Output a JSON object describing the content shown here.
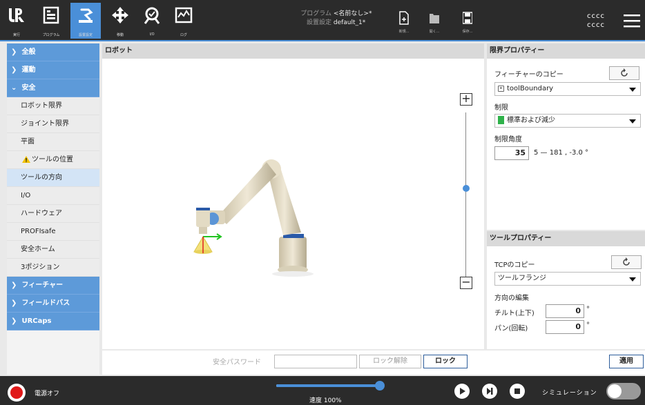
{
  "header": {
    "nav": [
      {
        "label": "実行",
        "icon": "ur-logo-icon"
      },
      {
        "label": "プログラム",
        "icon": "program-icon"
      },
      {
        "label": "設置設定",
        "icon": "installation-icon"
      },
      {
        "label": "移動",
        "icon": "move-icon"
      },
      {
        "label": "I/O",
        "icon": "io-icon"
      },
      {
        "label": "ログ",
        "icon": "log-icon"
      }
    ],
    "program_key": "プログラム",
    "program_value": "<名前なし>*",
    "install_key": "設置設定",
    "install_value": "default_1*",
    "file_new": "新規...",
    "file_open": "開く...",
    "file_save": "保存...",
    "user_line1": "cccc",
    "user_line2": "cccc",
    "accent_color": "#4a8fd8"
  },
  "sidebar": {
    "items": [
      {
        "label": "全般",
        "type": "category",
        "state": "collapsed"
      },
      {
        "label": "運動",
        "type": "category",
        "state": "collapsed"
      },
      {
        "label": "安全",
        "type": "category",
        "state": "expanded"
      },
      {
        "label": "ロボット限界",
        "type": "sub"
      },
      {
        "label": "ジョイント限界",
        "type": "sub"
      },
      {
        "label": "平面",
        "type": "sub"
      },
      {
        "label": "ツールの位置",
        "type": "sub",
        "warning": true
      },
      {
        "label": "ツールの方向",
        "type": "sub",
        "selected": true
      },
      {
        "label": "I/O",
        "type": "sub"
      },
      {
        "label": "ハードウェア",
        "type": "sub"
      },
      {
        "label": "PROFIsafe",
        "type": "sub"
      },
      {
        "label": "安全ホーム",
        "type": "sub"
      },
      {
        "label": "3ポジション",
        "type": "sub"
      },
      {
        "label": "フィーチャー",
        "type": "category",
        "state": "collapsed"
      },
      {
        "label": "フィールドバス",
        "type": "category",
        "state": "collapsed"
      },
      {
        "label": "URCaps",
        "type": "category",
        "state": "collapsed"
      }
    ]
  },
  "main": {
    "title": "ロボット"
  },
  "limit_props": {
    "title": "限界プロパティー",
    "copy_feature_label": "フィーチャーのコピー",
    "feature_value": "toolBoundary",
    "restriction_label": "制限",
    "restriction_value": "標準および減少",
    "angle_label": "制限角度",
    "angle_value": "35",
    "angle_range": "5 — 181 , -3.0 °"
  },
  "tool_props": {
    "title": "ツールプロパティー",
    "copy_tcp_label": "TCPのコピー",
    "tcp_value": "ツールフランジ",
    "edit_dir_label": "方向の編集",
    "tilt_label": "チルト(上下)",
    "tilt_value": "0",
    "pan_label": "パン(回転)",
    "pan_value": "0",
    "degree": "°"
  },
  "lockbar": {
    "password_label": "安全パスワード",
    "password_value": "",
    "unlock_label": "ロック解除",
    "lock_label": "ロック",
    "apply_label": "適用"
  },
  "footer": {
    "power_label": "電源オフ",
    "speed_label": "速度 100%",
    "speed_percent": 100,
    "sim_label": "シミュレーション",
    "sim_on": false
  }
}
